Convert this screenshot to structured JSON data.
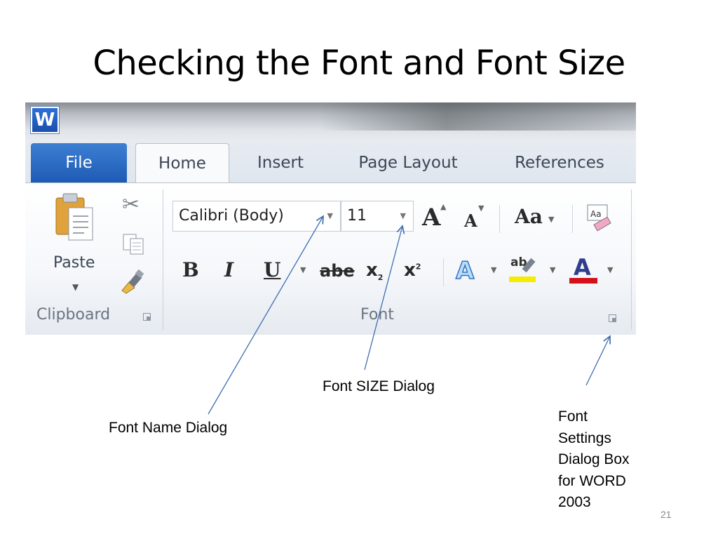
{
  "slide": {
    "title": "Checking the Font and Font Size",
    "page_number": "21"
  },
  "window": {
    "app_icon": "W"
  },
  "tabs": [
    {
      "label": "File"
    },
    {
      "label": "Home"
    },
    {
      "label": "Insert"
    },
    {
      "label": "Page Layout"
    },
    {
      "label": "References"
    }
  ],
  "clipboard": {
    "paste_label": "Paste",
    "group_label": "Clipboard"
  },
  "font_group": {
    "font_name": "Calibri (Body)",
    "font_size": "11",
    "group_label": "Font",
    "grow_label": "A",
    "shrink_label": "A",
    "case_label": "Aa",
    "bold_label": "B",
    "italic_label": "I",
    "underline_label": "U",
    "strike_label": "abe",
    "subscript_label": "x",
    "subscript_mark": "2",
    "superscript_label": "x",
    "superscript_mark": "2",
    "effects_label": "A",
    "highlight_label": "ab",
    "color_label": "A",
    "clear_label": "Aa"
  },
  "annotations": {
    "font_name": "Font Name Dialog",
    "font_size": "Font SIZE Dialog",
    "font_settings": [
      "Font",
      "Settings",
      "Dialog Box",
      "for WORD",
      "2003"
    ]
  },
  "colors": {
    "file_tab": "#2a6bc8",
    "highlight": "#f5ec00",
    "font_color": "#d4101b",
    "arrow": "#3f6fb0"
  }
}
